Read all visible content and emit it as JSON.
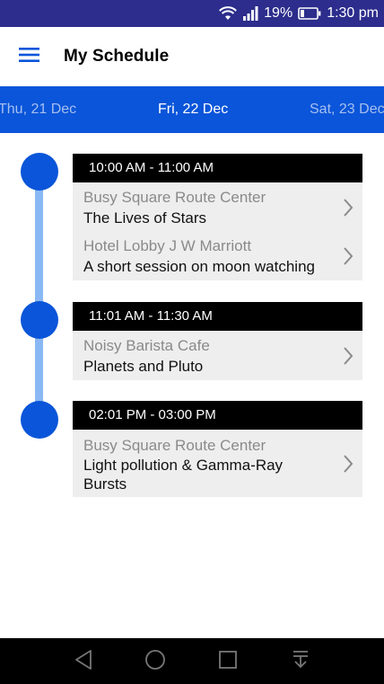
{
  "status_bar": {
    "battery_percent": "19%",
    "time": "1:30 pm",
    "icons": [
      "wifi-icon",
      "signal-icon",
      "battery-icon"
    ]
  },
  "app_bar": {
    "title": "My Schedule",
    "menu_icon": "hamburger-menu-icon"
  },
  "dates": {
    "prev": "Thu, 21 Dec",
    "current": "Fri, 22 Dec",
    "next": "Sat, 23 Dec"
  },
  "schedule": [
    {
      "time": "10:00 AM - 11:00 AM",
      "sessions": [
        {
          "location": "Busy Square Route Center",
          "title": "The Lives of Stars"
        },
        {
          "location": "Hotel Lobby J W Marriott",
          "title": "A short session on moon watching"
        }
      ]
    },
    {
      "time": "11:01 AM - 11:30 AM",
      "sessions": [
        {
          "location": "Noisy Barista Cafe",
          "title": "Planets and Pluto"
        }
      ]
    },
    {
      "time": "02:01 PM - 03:00 PM",
      "sessions": [
        {
          "location": "Busy Square Route Center",
          "title": "Light pollution & Gamma-Ray Bursts"
        }
      ]
    }
  ],
  "nav_bar": {
    "icons": [
      "back-icon",
      "home-icon",
      "recents-icon",
      "notification-pulldown-icon"
    ]
  },
  "colors": {
    "status_bar": "#2c2d8c",
    "accent": "#0a55d9",
    "timeline_line": "#8ab8f4",
    "session_bg": "#eeeeee",
    "time_bar": "#000000"
  }
}
